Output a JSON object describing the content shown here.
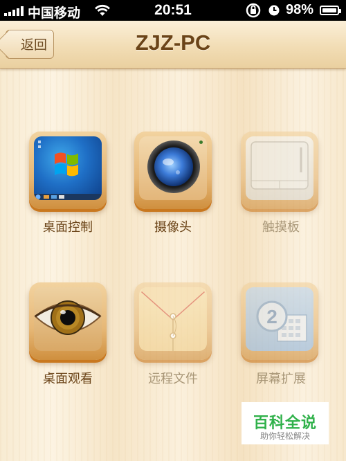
{
  "status_bar": {
    "carrier": "中国移动",
    "time": "20:51",
    "battery_percent": "98%",
    "battery_level": 0.98,
    "signal_icon": "signal-bars-icon",
    "wifi_icon": "wifi-icon",
    "rotation_lock_icon": "rotation-lock-icon",
    "alarm_icon": "alarm-icon"
  },
  "navbar": {
    "back_label": "返回",
    "title": "ZJZ-PC"
  },
  "grid": {
    "items": [
      {
        "label": "桌面控制",
        "icon": "windows-desktop-icon",
        "enabled": true
      },
      {
        "label": "摄像头",
        "icon": "camera-lens-icon",
        "enabled": true
      },
      {
        "label": "触摸板",
        "icon": "touchpad-icon",
        "enabled": false
      },
      {
        "label": "桌面观看",
        "icon": "eye-icon",
        "enabled": true
      },
      {
        "label": "远程文件",
        "icon": "envelope-icon",
        "enabled": false
      },
      {
        "label": "屏幕扩展",
        "icon": "screen-extend-icon",
        "enabled": false
      }
    ]
  },
  "extend_badge": "2",
  "watermark": {
    "title": "百科全说",
    "subtitle": "助你轻松解决"
  },
  "colors": {
    "nav_title": "#6b4418",
    "label_enabled": "#6b4418",
    "label_disabled": "#a89677",
    "watermark_green": "#2fb14a"
  }
}
